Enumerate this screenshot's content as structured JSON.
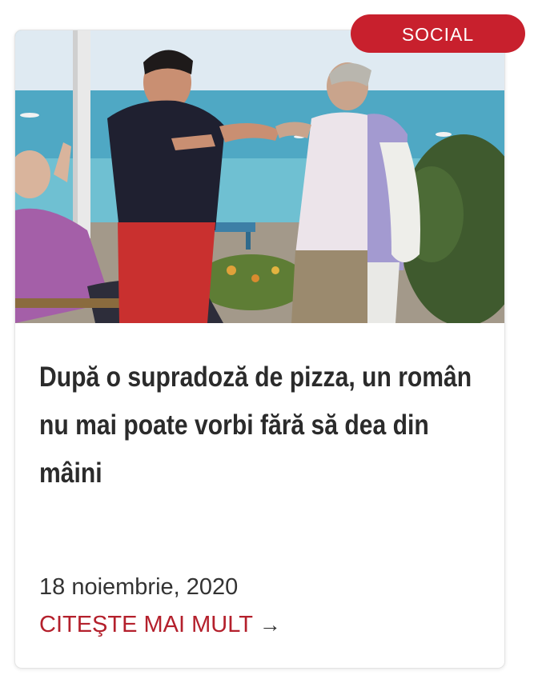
{
  "category": {
    "label": "SOCIAL"
  },
  "article": {
    "title": "După o supradoză de pizza, un român nu mai poate vorbi fără să dea din mâini",
    "date": "18 noiembrie, 2020",
    "read_more": "CITEŞTE MAI MULT",
    "arrow": "→"
  },
  "image": {
    "alt": ""
  },
  "colors": {
    "accent": "#c8202d",
    "link": "#b4202c",
    "title": "#2b2b2b"
  }
}
